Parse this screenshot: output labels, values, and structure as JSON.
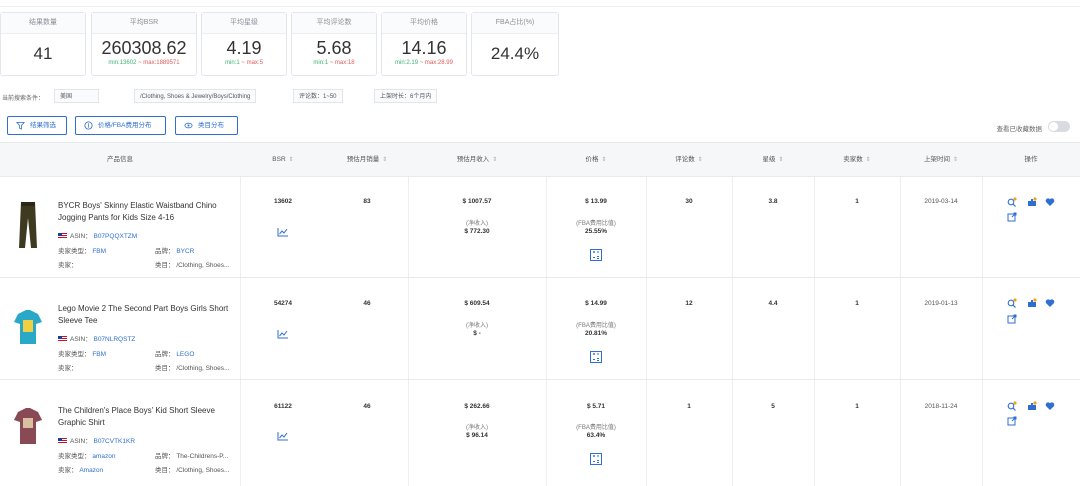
{
  "stats": [
    {
      "label": "结果数量",
      "value": "41"
    },
    {
      "label": "平均BSR",
      "value": "260308.62",
      "min": "min:13602",
      "max": "max:1889571"
    },
    {
      "label": "平均星级",
      "value": "4.19",
      "min": "min:1",
      "max": "max:5"
    },
    {
      "label": "平均评论数",
      "value": "5.68",
      "min": "min:1",
      "max": "max:18"
    },
    {
      "label": "平均价格",
      "value": "14.16",
      "min": "min:2.19",
      "max": "max:28.99"
    },
    {
      "label": "FBA占比(%)",
      "value": "24.4%"
    }
  ],
  "filters": {
    "label": "当前搜索条件：",
    "chips": [
      "美国",
      "/Clothing, Shoes & Jewelry/Boys/Clothing",
      "评论数：1~50",
      "上架时长：6个月内"
    ]
  },
  "buttons": {
    "filter": "结果筛选",
    "price": "价格/FBA费用分布",
    "category": "类目分布"
  },
  "toggle_label": "查看已收藏数据",
  "headers": {
    "product": "产品信息",
    "bsr": "BSR",
    "monthly_sales": "预估月销量",
    "monthly_revenue": "预估月收入",
    "price": "价格",
    "reviews": "评论数",
    "rating": "星级",
    "sellers": "卖家数",
    "listed": "上架时间",
    "actions": "操作"
  },
  "labels": {
    "asin": "ASIN：",
    "seller_type": "卖家类型：",
    "brand": "品牌：",
    "seller": "卖家：",
    "category": "类目：",
    "net": "(净收入)",
    "fba": "(FBA费用比值)"
  },
  "rows": [
    {
      "name": "BYCR Boys' Skinny Elastic Waistband Chino Jogging Pants for Kids Size 4-16",
      "asin": "B07PQQXTZM",
      "seller_type": "FBM",
      "brand": "BYCR",
      "seller": "",
      "category": "/Clothing, Shoes...",
      "bsr": "13602",
      "sales": "83",
      "revenue": "$ 1007.57",
      "net": "$ 772.30",
      "price": "$ 13.99",
      "fba": "25.55%",
      "reviews": "30",
      "rating": "3.8",
      "sellers": "1",
      "date": "2019-03-14"
    },
    {
      "name": "Lego Movie 2 The Second Part Boys Girls Short Sleeve Tee",
      "asin": "B07NLRQSTZ",
      "seller_type": "FBM",
      "brand": "LEGO",
      "seller": "",
      "category": "/Clothing, Shoes...",
      "bsr": "54274",
      "sales": "46",
      "revenue": "$ 609.54",
      "net": "$ -",
      "price": "$ 14.99",
      "fba": "20.81%",
      "reviews": "12",
      "rating": "4.4",
      "sellers": "1",
      "date": "2019-01-13"
    },
    {
      "name": "The Children's Place Boys' Kid Short Sleeve Graphic Shirt",
      "asin": "B07CVTK1KR",
      "seller_type": "amazon",
      "brand": "The-Childrens-P...",
      "seller": "Amazon",
      "category": "/Clothing, Shoes...",
      "bsr": "61122",
      "sales": "46",
      "revenue": "$ 262.66",
      "net": "$ 96.14",
      "price": "$ 5.71",
      "fba": "63.4%",
      "reviews": "1",
      "rating": "5",
      "sellers": "1",
      "date": "2018-11-24"
    }
  ],
  "colors": {
    "accent": "#2f6fd1",
    "min": "#3cb371",
    "max": "#e05a5a"
  }
}
